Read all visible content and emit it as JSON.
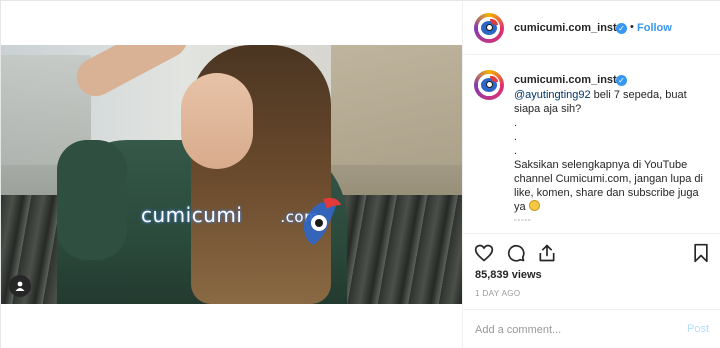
{
  "header": {
    "username": "cumicumi.com_insta",
    "follow_label": "Follow",
    "separator": "•"
  },
  "video": {
    "watermark_text": "cumicumi",
    "watermark_suffix": ".com"
  },
  "caption": {
    "username": "cumicumi.com_insta",
    "mention": "@ayutingting92",
    "line1_rest": " beli 7 sepeda, buat siapa aja sih?",
    "dots": [
      ".",
      ".",
      "."
    ],
    "body": "Saksikan selengkapnya di YouTube channel Cumicumi.com, jangan lupa di like, komen, share dan subscribe juga ya",
    "trailing": "▫▫▫▫▫"
  },
  "actions": {
    "icons": [
      "heart-icon",
      "comment-icon",
      "share-icon",
      "bookmark-icon"
    ]
  },
  "stats": {
    "views": "85,839 views",
    "time_ago": "1 DAY AGO"
  },
  "comment": {
    "placeholder": "Add a comment...",
    "post_label": "Post"
  },
  "colors": {
    "link_blue": "#3897f0",
    "verified_blue": "#3897f0",
    "post_disabled": "#b2dffc"
  }
}
